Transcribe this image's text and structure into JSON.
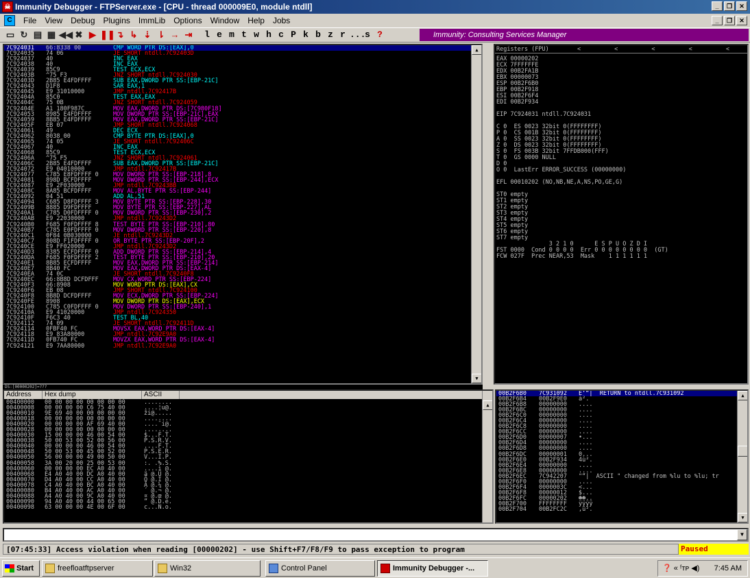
{
  "window": {
    "title": "Immunity Debugger - FTPServer.exe - [CPU - thread 000009E0, module ntdll]"
  },
  "menu": [
    "File",
    "View",
    "Debug",
    "Plugins",
    "ImmLib",
    "Options",
    "Window",
    "Help",
    "Jobs"
  ],
  "toolbar": {
    "letters": [
      "l",
      "e",
      "m",
      "t",
      "w",
      "h",
      "c",
      "P",
      "k",
      "b",
      "z",
      "r",
      "...",
      "s",
      "?"
    ]
  },
  "banner": "Immunity: Consulting Services Manager",
  "disasm": [
    {
      "a": "7C924031",
      "h": "66:8338 00",
      "i": "CMP WORD PTR DS:[EAX],0",
      "c": "#00ffff"
    },
    {
      "a": "7C924035",
      "h": "74 06",
      "i": "JE SHORT ntdll.7C92403D",
      "c": "#ff0000"
    },
    {
      "a": "7C924037",
      "h": "40",
      "i": "INC EAX",
      "c": "#00ffff"
    },
    {
      "a": "7C924038",
      "h": "40",
      "i": "INC EAX",
      "c": "#00ffff"
    },
    {
      "a": "7C924039",
      "h": "85C9",
      "i": "TEST ECX,ECX",
      "c": "#00ffff"
    },
    {
      "a": "7C92403B",
      "h": "^75 F3",
      "i": "JNZ SHORT ntdll.7C924030",
      "c": "#ff0000"
    },
    {
      "a": "7C92403D",
      "h": "2B85 E4FDFFFF",
      "i": "SUB EAX,DWORD PTR SS:[EBP-21C]",
      "c": "#00ffff"
    },
    {
      "a": "7C924043",
      "h": "D1F8",
      "i": "SAR EAX,1",
      "c": "#00ffff"
    },
    {
      "a": "7C924045",
      "h": "E9 31010000",
      "i": "JMP ntdll.7C92417B",
      "c": "#ff0000"
    },
    {
      "a": "7C92404A",
      "h": "85C0",
      "i": "TEST EAX,EAX",
      "c": "#00ffff"
    },
    {
      "a": "7C92404C",
      "h": "75 0B",
      "i": "JNZ SHORT ntdll.7C924059",
      "c": "#ff0000"
    },
    {
      "a": "7C92404E",
      "h": "A1 180F987C",
      "i": "MOV EAX,DWORD PTR DS:[7C980F18]",
      "c": "#ff00ff"
    },
    {
      "a": "7C924053",
      "h": "8985 E4FDFFFF",
      "i": "MOV DWORD PTR SS:[EBP-21C],EAX",
      "c": "#ff00ff"
    },
    {
      "a": "7C924059",
      "h": "8B85 E4FDFFFF",
      "i": "MOV EAX,DWORD PTR SS:[EBP-21C]",
      "c": "#ff00ff"
    },
    {
      "a": "7C92405F",
      "h": "EB 07",
      "i": "JMP SHORT ntdll.7C924068",
      "c": "#ff0000"
    },
    {
      "a": "7C924061",
      "h": "49",
      "i": "DEC ECX",
      "c": "#00ffff"
    },
    {
      "a": "7C924062",
      "h": "8038 00",
      "i": "CMP BYTE PTR DS:[EAX],0",
      "c": "#00ffff"
    },
    {
      "a": "7C924065",
      "h": "74 05",
      "i": "JE SHORT ntdll.7C92406C",
      "c": "#ff0000"
    },
    {
      "a": "7C924067",
      "h": "40",
      "i": "INC EAX",
      "c": "#00ffff"
    },
    {
      "a": "7C924068",
      "h": "85C9",
      "i": "TEST ECX,ECX",
      "c": "#00ffff"
    },
    {
      "a": "7C92406A",
      "h": "^75 F5",
      "i": "JNZ SHORT ntdll.7C924061",
      "c": "#ff0000"
    },
    {
      "a": "7C92406C",
      "h": "2B85 E4FDFFFF",
      "i": "SUB EAX,DWORD PTR SS:[EBP-21C]",
      "c": "#00ffff"
    },
    {
      "a": "7C924072",
      "h": "E9 04010000",
      "i": "JMP ntdll.7C92417B",
      "c": "#ff0000"
    },
    {
      "a": "7C924077",
      "h": "C785 E8FDFFFF 0",
      "i": "MOV DWORD PTR SS:[EBP-218],8",
      "c": "#ff00ff"
    },
    {
      "a": "7C924081",
      "h": "898D BCFDFFFF",
      "i": "MOV DWORD PTR SS:[EBP-244],ECX",
      "c": "#ff00ff"
    },
    {
      "a": "7C924087",
      "h": "E9 2F030000",
      "i": "JMP ntdll.7C9243BB",
      "c": "#ff0000"
    },
    {
      "a": "7C92408C",
      "h": "8A85 BCFDFFFF",
      "i": "MOV AL,BYTE PTR SS:[EBP-244]",
      "c": "#ff00ff"
    },
    {
      "a": "7C924092",
      "h": "04 51",
      "i": "ADD AL,51",
      "c": "#00ffff"
    },
    {
      "a": "7C924094",
      "h": "C685 D8FDFFFF 3",
      "i": "MOV BYTE PTR SS:[EBP-228],30",
      "c": "#ff00ff"
    },
    {
      "a": "7C92409B",
      "h": "8885 D9FDFFFF",
      "i": "MOV BYTE PTR SS:[EBP-227],AL",
      "c": "#ff00ff"
    },
    {
      "a": "7C9240A1",
      "h": "C785 D0FDFFFF 0",
      "i": "MOV DWORD PTR SS:[EBP-230],2",
      "c": "#ff00ff"
    },
    {
      "a": "7C9240AB",
      "h": "E9 22030000",
      "i": "JMP ntdll.7C9243D2",
      "c": "#ff0000"
    },
    {
      "a": "7C9240B0",
      "h": "F685 F0FDFFFF 8",
      "i": "TEST BYTE PTR SS:[EBP-210],80",
      "c": "#ff00ff"
    },
    {
      "a": "7C9240B7",
      "h": "C785 E0FDFFFF 0",
      "i": "MOV DWORD PTR SS:[EBP-220],8",
      "c": "#ff00ff"
    },
    {
      "a": "7C9240C1",
      "h": "0F84 0B030000",
      "i": "JE ntdll.7C9243D2",
      "c": "#ff0000"
    },
    {
      "a": "7C9240C7",
      "h": "808D F1FDFFFF 0",
      "i": "OR BYTE PTR SS:[EBP-20F],2",
      "c": "#ff00ff"
    },
    {
      "a": "7C9240CE",
      "h": "E9 FF020000",
      "i": "JMP ntdll.7C9243D2",
      "c": "#ff0000"
    },
    {
      "a": "7C9240D3",
      "h": "8385 ECFDFFFF 0",
      "i": "ADD DWORD PTR SS:[EBP-214],4",
      "c": "#ff00ff"
    },
    {
      "a": "7C9240DA",
      "h": "F685 F0FDFFFF 2",
      "i": "TEST BYTE PTR SS:[EBP-210],20",
      "c": "#ff00ff"
    },
    {
      "a": "7C9240E1",
      "h": "8B85 ECFDFFFF",
      "i": "MOV EAX,DWORD PTR SS:[EBP-214]",
      "c": "#ff00ff"
    },
    {
      "a": "7C9240E7",
      "h": "8B40 FC",
      "i": "MOV EAX,DWORD PTR DS:[EAX-4]",
      "c": "#ff00ff"
    },
    {
      "a": "7C9240EA",
      "h": "74 0C",
      "i": "JE SHORT ntdll.7C9240F8",
      "c": "#ff0000"
    },
    {
      "a": "7C9240EC",
      "h": "66:8B8D DCFDFFF",
      "i": "MOV CX,WORD PTR SS:[EBP-224]",
      "c": "#ff00ff"
    },
    {
      "a": "7C9240F3",
      "h": "66:8908",
      "i": "MOV WORD PTR DS:[EAX],CX",
      "c": "#ffff00"
    },
    {
      "a": "7C9240F6",
      "h": "EB 08",
      "i": "JMP SHORT ntdll.7C924100",
      "c": "#ff0000"
    },
    {
      "a": "7C9240F8",
      "h": "8B8D DCFDFFFF",
      "i": "MOV ECX,DWORD PTR SS:[EBP-224]",
      "c": "#ff00ff"
    },
    {
      "a": "7C9240FE",
      "h": "8908",
      "i": "MOV DWORD PTR DS:[EAX],ECX",
      "c": "#ffff00"
    },
    {
      "a": "7C924100",
      "h": "C785 C0FDFFFF 0",
      "i": "MOV DWORD PTR SS:[EBP-240],1",
      "c": "#ff00ff"
    },
    {
      "a": "7C92410A",
      "h": "E9 41020000",
      "i": "JMP ntdll.7C924350",
      "c": "#ff0000"
    },
    {
      "a": "7C92410F",
      "h": "F6C3 40",
      "i": "TEST BL,40",
      "c": "#00ffff"
    },
    {
      "a": "7C924112",
      "h": "74 09",
      "i": "JE SHORT ntdll.7C92411D",
      "c": "#ff0000"
    },
    {
      "a": "7C924114",
      "h": "0FBF40 FC",
      "i": "MOVSX EAX,WORD PTR DS:[EAX-4]",
      "c": "#ff00ff"
    },
    {
      "a": "7C924118",
      "h": "E9 83A80000",
      "i": "JMP ntdll.7C92E9A0",
      "c": "#ff0000"
    },
    {
      "a": "7C92411D",
      "h": "0FB740 FC",
      "i": "MOVZX EAX,WORD PTR DS:[EAX-4]",
      "c": "#ff00ff"
    },
    {
      "a": "7C924121",
      "h": "E9 7AA80000",
      "i": "JMP ntdll.7C92E9A0",
      "c": "#ff0000"
    }
  ],
  "registers": {
    "header": "Registers (FPU)",
    "arrows": "< < < < <",
    "lines": [
      "EAX 00000202",
      "ECX 7FFFFFFE",
      "EDX 00B2FA1B",
      "EBX 00000073",
      "ESP 00B2F6B0",
      "EBP 00B2F918",
      "ESI 00B2F6F4",
      "EDI 00B2F934",
      "",
      "EIP 7C924031 ntdll.7C924031",
      "",
      "C 0  ES 0023 32bit 0(FFFFFFFF)",
      "P 0  CS 001B 32bit 0(FFFFFFFF)",
      "A 0  SS 0023 32bit 0(FFFFFFFF)",
      "Z 0  DS 0023 32bit 0(FFFFFFFF)",
      "S 0  FS 003B 32bit 7FFDB000(FFF)",
      "T 0  GS 0000 NULL",
      "D 0",
      "O 0  LastErr ERROR_SUCCESS (00000000)",
      "",
      "EFL 00010202 (NO,NB,NE,A,NS,PO,GE,G)",
      "",
      "ST0 empty",
      "ST1 empty",
      "ST2 empty",
      "ST3 empty",
      "ST4 empty",
      "ST5 empty",
      "ST6 empty",
      "ST7 empty",
      "               3 2 1 0      E S P U O Z D I",
      "FST 0000  Cond 0 0 0 0  Err 0 0 0 0 0 0 0 0  (GT)",
      "FCW 027F  Prec NEAR,53  Mask    1 1 1 1 1 1"
    ]
  },
  "status_addr": "DS:[00000202]=???",
  "dump": {
    "headers": [
      "Address",
      "Hex dump",
      "ASCII"
    ],
    "rows": [
      [
        "00400000",
        "00 00 00 00 00 00 00 00",
        "........"
      ],
      [
        "00400008",
        "00 00 00 00 C6 75 40 00",
        "....¦u@."
      ],
      [
        "00400010",
        "9E 69 40 00 00 00 00 00",
        "ži@....."
      ],
      [
        "00400018",
        "00 00 00 00 00 00 00 00",
        "........"
      ],
      [
        "00400020",
        "00 00 00 00 AF 69 40 00",
        "....¯i@."
      ],
      [
        "00400028",
        "00 00 00 00 00 00 00 00",
        "........"
      ],
      [
        "00400030",
        "15 00 00 00 46 00 54 00",
        "$...F.T."
      ],
      [
        "00400038",
        "50 00 53 00 52 00 56 00",
        "P.S.R.V."
      ],
      [
        "00400040",
        "00 00 00 00 46 00 54 00",
        "....F.T."
      ],
      [
        "00400048",
        "50 00 53 00 45 00 52 00",
        "P.S.E.R."
      ],
      [
        "00400050",
        "56 00 00 00 49 00 50 00",
        "V...I.P."
      ],
      [
        "00400058",
        "3A 00 20 00 25 00 53 00",
        ":. .%.S."
      ],
      [
        "00400060",
        "00 00 00 00 EC A0 40 00",
        "....ì @."
      ],
      [
        "00400068",
        "E4 A0 40 00 DC A0 40 00",
        "ä @.Ü @."
      ],
      [
        "00400070",
        "D4 A0 40 00 CC A0 40 00",
        "Ô @.Ì @."
      ],
      [
        "00400078",
        "C4 A0 40 00 BC A0 40 00",
        "Ä @.¼ @."
      ],
      [
        "00400080",
        "B4 A0 40 00 AC A0 40 00",
        "´ @.¬ @."
      ],
      [
        "00400088",
        "A4 A0 40 00 9C A0 40 00",
        "¤ @.œ @."
      ],
      [
        "00400090",
        "94 A0 40 00 44 00 65 00",
        "” @.D.e."
      ],
      [
        "00400098",
        "63 00 00 00 4E 00 6F 00",
        "c...N.o."
      ]
    ]
  },
  "stack": [
    {
      "a": "00B2F6B0",
      "v": "7C931092",
      "t": "È‘“|  RETURN to ntdll.7C931092",
      "sel": true
    },
    {
      "a": "00B2F6B4",
      "v": "00B2F9E0",
      "t": "à²."
    },
    {
      "a": "00B2F6B8",
      "v": "00000000",
      "t": "...."
    },
    {
      "a": "00B2F6BC",
      "v": "00000000",
      "t": "...."
    },
    {
      "a": "00B2F6C0",
      "v": "00000000",
      "t": "...."
    },
    {
      "a": "00B2F6C4",
      "v": "00000000",
      "t": "...."
    },
    {
      "a": "00B2F6C8",
      "v": "00000000",
      "t": "...."
    },
    {
      "a": "00B2F6CC",
      "v": "00000000",
      "t": "...."
    },
    {
      "a": "00B2F6D0",
      "v": "00000007",
      "t": "•..."
    },
    {
      "a": "00B2F6D4",
      "v": "00000000",
      "t": "...."
    },
    {
      "a": "00B2F6D8",
      "v": "00000000",
      "t": "...."
    },
    {
      "a": "00B2F6DC",
      "v": "00000001",
      "t": "0..."
    },
    {
      "a": "00B2F6E0",
      "v": "00B2F934",
      "t": "4ù²."
    },
    {
      "a": "00B2F6E4",
      "v": "00000000",
      "t": "...."
    },
    {
      "a": "00B2F6E8",
      "v": "00000000",
      "t": "...."
    },
    {
      "a": "00B2F6EC",
      "v": "7C942207",
      "t": "\"“|  ASCII \" changed from %lu to %lu; tr"
    },
    {
      "a": "00B2F6F0",
      "v": "00000000",
      "t": "...."
    },
    {
      "a": "00B2F6F4",
      "v": "0000003C",
      "t": "<..."
    },
    {
      "a": "00B2F6F8",
      "v": "00000012",
      "t": "$..."
    },
    {
      "a": "00B2F6FC",
      "v": "00000202",
      "t": "☻☻.."
    },
    {
      "a": "00B2F700",
      "v": "FFFFFFFF",
      "t": "ÿÿÿÿ"
    },
    {
      "a": "00B2F704",
      "v": "00B2FC2C",
      "t": ",ü²."
    }
  ],
  "message": "[07:45:33] Access violation when reading [00000202] - use Shift+F7/F8/F9 to pass exception to program",
  "state": "Paused",
  "taskbar": {
    "start": "Start",
    "items": [
      {
        "label": "freefloatftpserver",
        "active": false
      },
      {
        "label": "Win32",
        "active": false
      },
      {
        "label": "Control Panel",
        "active": false
      },
      {
        "label": "Immunity Debugger -...",
        "active": true
      }
    ],
    "clock": "7:45 AM"
  },
  "colors": {
    "banner": "#800080",
    "selection": "#000080",
    "paused_bg": "#ffff00",
    "paused_fg": "#cc0000"
  }
}
